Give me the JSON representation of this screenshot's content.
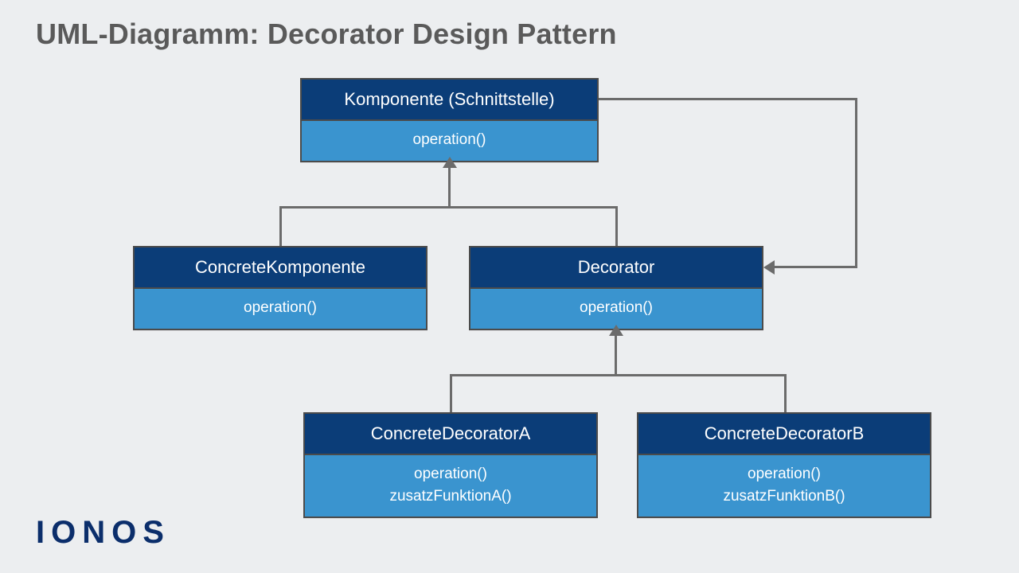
{
  "title": "UML-Diagramm: Decorator Design Pattern",
  "logo": "IONOS",
  "nodes": {
    "component": {
      "title": "Komponente (Schnittstelle)",
      "methods": "operation()"
    },
    "concreteComponent": {
      "title": "ConcreteKomponente",
      "methods": "operation()"
    },
    "decorator": {
      "title": "Decorator",
      "methods": "operation()"
    },
    "concreteDecoratorA": {
      "title": "ConcreteDecoratorA",
      "methods": "operation()\nzusatzFunktionA()"
    },
    "concreteDecoratorB": {
      "title": "ConcreteDecoratorB",
      "methods": "operation()\nzusatzFunktionB()"
    }
  },
  "colors": {
    "nodeHeader": "#0b3d78",
    "nodeBody": "#3a94cf",
    "line": "#6b6b6b",
    "background": "#eceef0",
    "title": "#5a5a5a",
    "logo": "#0b2e6b"
  }
}
